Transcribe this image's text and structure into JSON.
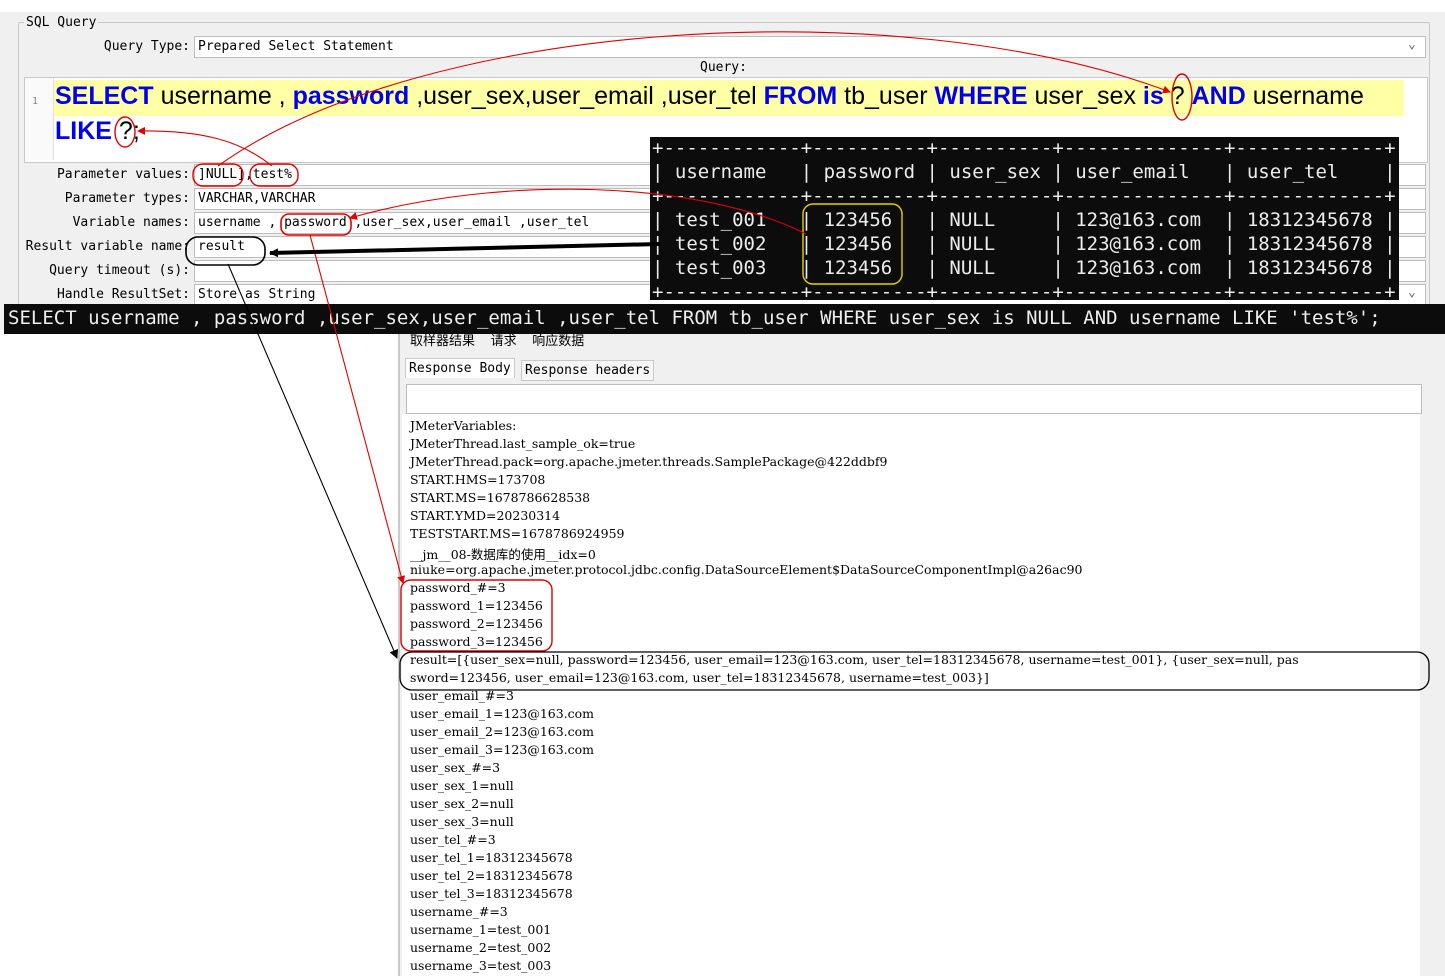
{
  "panel": {
    "legend": "SQL Query",
    "query_type_label": "Query Type:",
    "query_type_value": "Prepared Select Statement",
    "query_label": "Query:",
    "line_number": "1",
    "sql_line1": [
      "SELECT",
      " username , ",
      "password",
      " ,user_sex,user_email ,user_tel ",
      "FROM",
      " tb_user ",
      "WHERE",
      " user_sex ",
      "is",
      " ",
      "?",
      " ",
      "AND",
      " username"
    ],
    "sql_line2": [
      "LIKE",
      " ",
      "?",
      ";"
    ],
    "fields": [
      {
        "label": "Parameter values:",
        "value": "]NULL],test%"
      },
      {
        "label": "Parameter types:",
        "value": "VARCHAR,VARCHAR"
      },
      {
        "label": "Variable names:",
        "value": "username , password ,user_sex,user_email ,user_tel"
      },
      {
        "label": "Result variable name:",
        "value": "result"
      },
      {
        "label": "Query timeout (s):",
        "value": ""
      },
      {
        "label": "Handle ResultSet:",
        "value": "Store as String"
      }
    ]
  },
  "console": {
    "border": "+------------+----------+----------+--------------+-------------+",
    "header": "| username   | password | user_sex | user_email   | user_tel    |",
    "rows": [
      "| test_001   | 123456   | NULL     | 123@163.com  | 18312345678 |",
      "| test_002   | 123456   | NULL     | 123@163.com  | 18312345678 |",
      "| test_003   | 123456   | NULL     | 123@163.com  | 18312345678 |"
    ]
  },
  "banner": "SELECT username , password ,user_sex,user_email ,user_tel FROM tb_user WHERE user_sex is NULL AND username LIKE 'test%';",
  "results": {
    "top_tabs": "取样器结果  请求  响应数据",
    "tab_body": "Response Body",
    "tab_headers": "Response headers",
    "lines": [
      "JMeterVariables:",
      "JMeterThread.last_sample_ok=true",
      "JMeterThread.pack=org.apache.jmeter.threads.SamplePackage@422ddbf9",
      "START.HMS=173708",
      "START.MS=1678786628538",
      "START.YMD=20230314",
      "TESTSTART.MS=1678786924959",
      "__jm__08-数据库的使用__idx=0",
      "niuke=org.apache.jmeter.protocol.jdbc.config.DataSourceElement$DataSourceComponentImpl@a26ac90",
      "password_#=3",
      "password_1=123456",
      "password_2=123456",
      "password_3=123456",
      "result=[{user_sex=null, password=123456, user_email=123@163.com, user_tel=18312345678, username=test_001}, {user_sex=null, pas",
      "sword=123456, user_email=123@163.com, user_tel=18312345678, username=test_003}]",
      "user_email_#=3",
      "user_email_1=123@163.com",
      "user_email_2=123@163.com",
      "user_email_3=123@163.com",
      "user_sex_#=3",
      "user_sex_1=null",
      "user_sex_2=null",
      "user_sex_3=null",
      "user_tel_#=3",
      "user_tel_1=18312345678",
      "user_tel_2=18312345678",
      "user_tel_3=18312345678",
      "username_#=3",
      "username_1=test_001",
      "username_2=test_002",
      "username_3=test_003"
    ]
  },
  "colors": {
    "keyword": "#0000ee",
    "highlight": "#ffffa6",
    "annotation_red": "#e00000",
    "annotation_black": "#000000",
    "annotation_yellow": "#e6d200"
  }
}
